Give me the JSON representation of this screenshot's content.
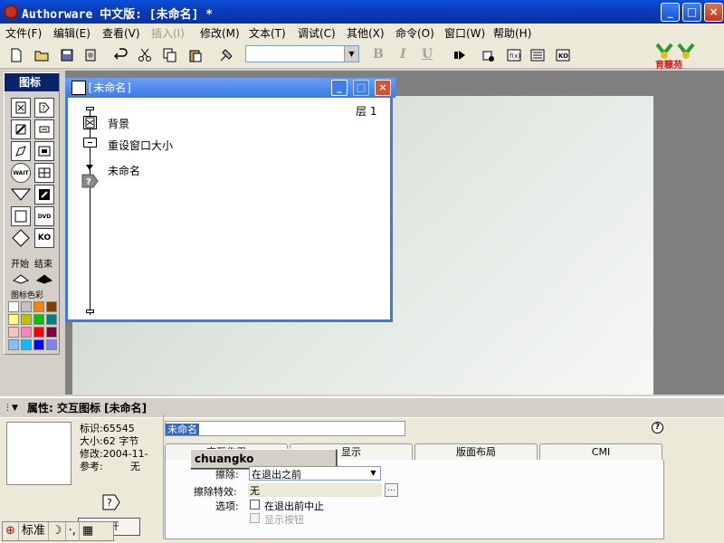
{
  "app": {
    "title": "Authorware 中文版: [未命名] *",
    "window_controls": {
      "minimize": "_",
      "maximize": "□",
      "close": "×"
    }
  },
  "menu": [
    {
      "label": "文件(F)",
      "disabled": false
    },
    {
      "label": "编辑(E)",
      "disabled": false
    },
    {
      "label": "查看(V)",
      "disabled": false
    },
    {
      "label": "插入(I)",
      "disabled": true
    },
    {
      "label": "修改(M)",
      "disabled": false
    },
    {
      "label": "文本(T)",
      "disabled": false
    },
    {
      "label": "调试(C)",
      "disabled": false
    },
    {
      "label": "其他(X)",
      "disabled": false
    },
    {
      "label": "命令(O)",
      "disabled": false
    },
    {
      "label": "窗口(W)",
      "disabled": false
    },
    {
      "label": "帮助(H)",
      "disabled": false
    }
  ],
  "toolbar": {
    "font_value": "",
    "bold": "B",
    "italic": "I",
    "underline": "U",
    "logo_text": "育糠苑"
  },
  "palette": {
    "title": "图标",
    "start_label": "开始",
    "end_label": "结束",
    "color_label": "图标色彩",
    "icons": [
      "display-icon",
      "motion-icon",
      "erase-icon",
      "wait-icon",
      "navigate-icon",
      "framework-icon",
      "decision-icon",
      "interaction-icon",
      "calculation-icon",
      "map-icon",
      "digital-movie-icon",
      "sound-icon",
      "video-icon",
      "knowledge-object-icon"
    ],
    "icon_glyphs": {
      "wait": "WAIT",
      "video": "DVD",
      "knowledge": "KO"
    },
    "swatches": [
      "#ffffff",
      "#c0c0c0",
      "#ff8000",
      "#804000",
      "#ffff80",
      "#c0c000",
      "#00c000",
      "#008080",
      "#ffc0c0",
      "#ff80c0",
      "#ff0000",
      "#800040",
      "#80c0ff",
      "#00c0ff",
      "#0000ff",
      "#8080ff"
    ]
  },
  "flow_window": {
    "title": "[未命名]",
    "level": "层 1",
    "items": [
      {
        "label": "背景",
        "icon": "display-icon"
      },
      {
        "label": "重设窗口大小",
        "icon": "calculation-icon"
      },
      {
        "label": "未命名",
        "icon": "interaction-icon"
      }
    ]
  },
  "properties": {
    "header": "属性: 交互图标 [未命名]",
    "info": {
      "id": "标识:65545",
      "size": "大小:62 字节",
      "modified": "修改:2004-11-",
      "reference": "参考:",
      "reference_value": "无"
    },
    "open_button": "打开",
    "name_value": "未命名",
    "autocomplete": "chuangko",
    "tabs": [
      "交互作用",
      "显示",
      "版面布局",
      "CMI"
    ],
    "erase_label": "擦除:",
    "erase_value": "在退出之前",
    "erase_effect_label": "擦除特效:",
    "erase_effect_value": "无",
    "options_label": "选项:",
    "option_pause": "在退出前中止",
    "option_button": "显示按钮",
    "help": "?"
  },
  "ime": {
    "mode": "标准",
    "moon": "☽",
    "dot": "·,",
    "keyboard": "▦"
  }
}
